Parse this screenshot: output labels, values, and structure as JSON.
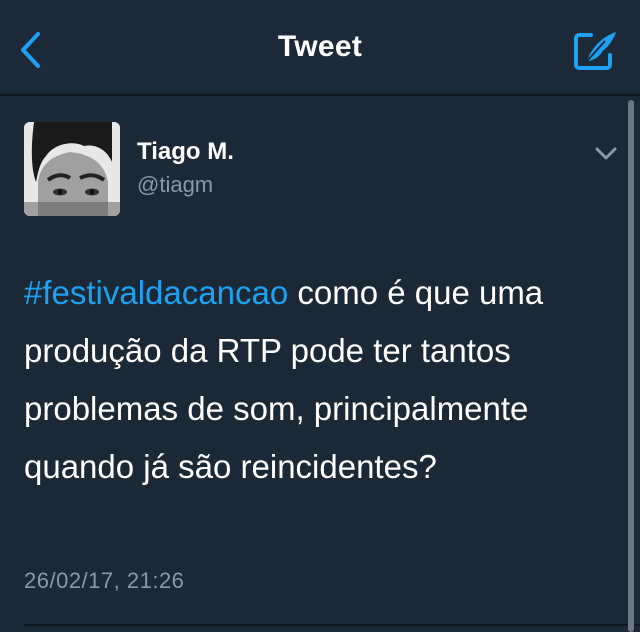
{
  "nav": {
    "title": "Tweet",
    "back_icon": "chevron-left-icon",
    "compose_icon": "compose-tweet-icon"
  },
  "tweet": {
    "author": {
      "name": "Tiago M.",
      "handle": "@tiagm"
    },
    "hashtag": "#festivaldacancao",
    "text": " como é que uma produção da RTP pode ter tantos problemas de som, principalmente quando já são reincidentes?",
    "timestamp": "26/02/17, 21:26"
  },
  "colors": {
    "background": "#1b2836",
    "accent": "#1da1f2",
    "secondary_text": "#8899a6"
  }
}
